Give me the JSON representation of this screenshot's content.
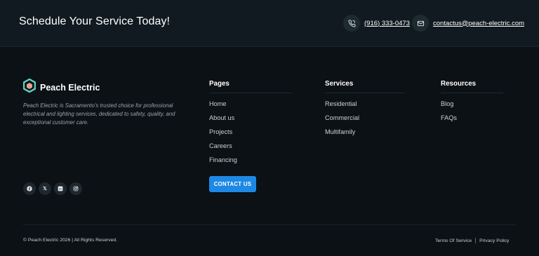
{
  "cta": {
    "title": "Schedule Your Service Today!",
    "phone": "(916) 333-0473",
    "phone_icon": "phone-icon",
    "email": "contactus@peach-electric.com",
    "email_icon": "mail-icon"
  },
  "brand": {
    "name": "Peach Electric",
    "logo_icon": "hexagon-logo-icon",
    "description": "Peach Electric is Sacramento's trusted choice for professional electrical and lighting services, dedicated to safety, quality, and exceptional customer care."
  },
  "socials": [
    {
      "icon": "facebook-icon"
    },
    {
      "icon": "x-icon",
      "glyph": "𝕏"
    },
    {
      "icon": "linkedin-icon",
      "glyph": "in"
    },
    {
      "icon": "instagram-icon"
    }
  ],
  "pages": {
    "title": "Pages",
    "items": [
      "Home",
      "About us",
      "Projects",
      "Careers",
      "Financing"
    ],
    "button": "CONTACT US"
  },
  "services": {
    "title": "Services",
    "items": [
      "Residential",
      "Commercial",
      "Multifamily"
    ]
  },
  "resources": {
    "title": "Resources",
    "items": [
      "Blog",
      "FAQs"
    ]
  },
  "footer": {
    "copyright": "© Peach Electric 2026 | All Rights Reserved.",
    "terms": "Terms Of Service",
    "privacy": "Privacy Policy"
  },
  "colors": {
    "background": "#0b1115",
    "topbar": "#111a20",
    "accent": "#1e88e5",
    "logo": "#5fd3c4"
  }
}
